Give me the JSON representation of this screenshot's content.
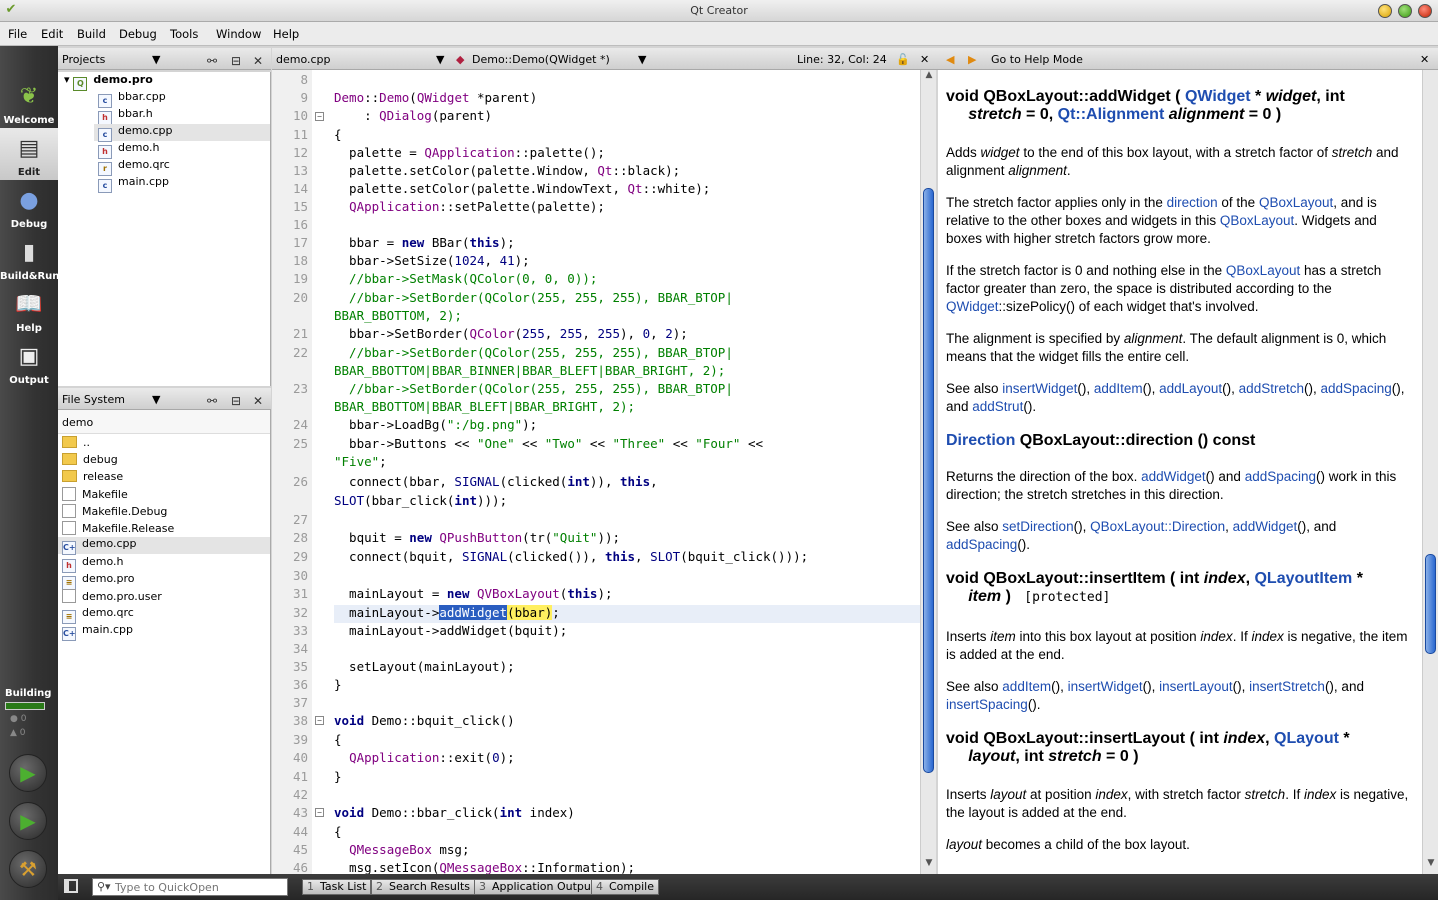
{
  "window": {
    "title": "Qt Creator"
  },
  "menu": [
    "File",
    "Edit",
    "Build",
    "Debug",
    "Tools",
    "Window",
    "Help"
  ],
  "modes": [
    {
      "label": "Welcome",
      "icon": "welcome-icon"
    },
    {
      "label": "Edit",
      "icon": "edit-icon"
    },
    {
      "label": "Debug",
      "icon": "debug-icon"
    },
    {
      "label": "Build&Run",
      "icon": "build-run-icon"
    },
    {
      "label": "Help",
      "icon": "help-book-icon"
    },
    {
      "label": "Output",
      "icon": "output-icon"
    }
  ],
  "building": {
    "label": "Building",
    "errors": "0",
    "warnings": "0"
  },
  "projects": {
    "header": "Projects",
    "root": "demo.pro",
    "files": [
      "bbar.cpp",
      "bbar.h",
      "demo.cpp",
      "demo.h",
      "demo.qrc",
      "main.cpp"
    ]
  },
  "filesystem": {
    "header": "File System",
    "path": "demo",
    "entries": [
      "..",
      "debug",
      "release",
      "Makefile",
      "Makefile.Debug",
      "Makefile.Release",
      "demo.cpp",
      "demo.h",
      "demo.pro",
      "demo.pro.user",
      "demo.qrc",
      "main.cpp"
    ]
  },
  "editor": {
    "file": "demo.cpp",
    "symbol": "Demo::Demo(QWidget *)",
    "position": "Line: 32, Col: 24"
  },
  "help": {
    "back": "◀",
    "forward": "▶",
    "title": "Go to Help Mode"
  },
  "quickopen": {
    "placeholder": "Type to QuickOpen"
  },
  "output_tabs": [
    {
      "n": "1",
      "label": "Task List"
    },
    {
      "n": "2",
      "label": "Search Results"
    },
    {
      "n": "3",
      "label": "Application Output"
    },
    {
      "n": "4",
      "label": "Compile"
    }
  ],
  "code_lines": [
    "8",
    "9",
    "10",
    "11",
    "12",
    "13",
    "14",
    "15",
    "16",
    "17",
    "18",
    "19",
    "20",
    "",
    "21",
    "22",
    "",
    "23",
    "",
    "24",
    "25",
    "",
    "26",
    "",
    "27",
    "28",
    "29",
    "30",
    "31",
    "32",
    "33",
    "34",
    "35",
    "36",
    "37",
    "38",
    "39",
    "40",
    "41",
    "42",
    "43",
    "44",
    "45",
    "46"
  ]
}
